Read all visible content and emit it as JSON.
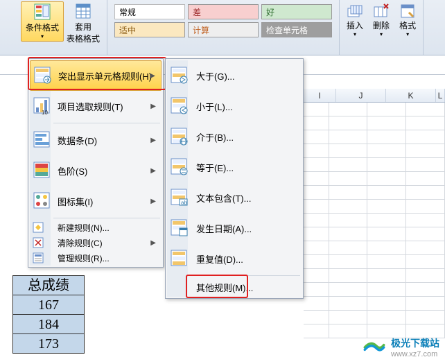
{
  "ribbon": {
    "cond_format": "条件格式",
    "table_format": "套用\n表格格式",
    "insert": "插入",
    "delete": "删除",
    "format": "格式",
    "styles": {
      "normal": "常规",
      "bad": "差",
      "good": "好",
      "moderate": "适中",
      "calc": "计算",
      "check_cell": "检查单元格"
    }
  },
  "columns": {
    "i": "I",
    "j": "J",
    "k": "K",
    "l": "L"
  },
  "menu1": {
    "highlight_rules": "突出显示单元格规则(H)",
    "top_bottom": "项目选取规则(T)",
    "data_bars": "数据条(D)",
    "color_scales": "色阶(S)",
    "icon_sets": "图标集(I)",
    "new_rule": "新建规则(N)...",
    "clear_rules": "清除规则(C)",
    "manage_rules": "管理规则(R)..."
  },
  "menu2": {
    "greater": "大于(G)...",
    "less": "小于(L)...",
    "between": "介于(B)...",
    "equal": "等于(E)...",
    "text_contains": "文本包含(T)...",
    "date": "发生日期(A)...",
    "duplicate": "重复值(D)...",
    "more_rules": "其他规则(M)..."
  },
  "table": {
    "header": "总成绩",
    "r1": "167",
    "r2": "184",
    "r3": "173"
  },
  "logo": {
    "name": "极光下载站",
    "url": "www.xz7.com"
  }
}
